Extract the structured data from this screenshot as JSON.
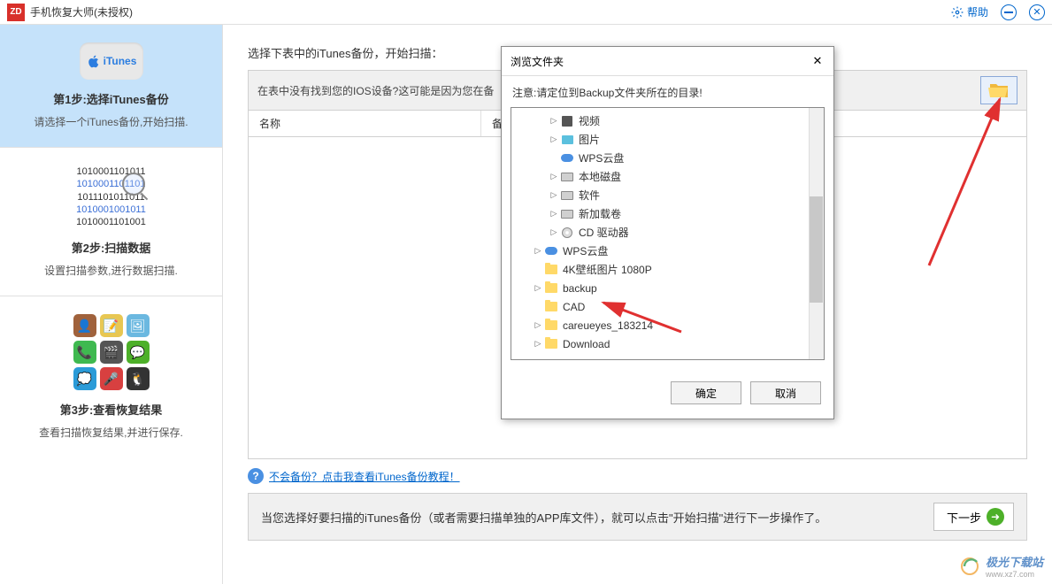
{
  "titlebar": {
    "app_abbr": "ZD",
    "title": "手机恢复大师(未授权)",
    "help": "帮助"
  },
  "sidebar": {
    "step1": {
      "itunes": "iTunes",
      "title": "第1步:选择iTunes备份",
      "desc": "请选择一个iTunes备份,开始扫描."
    },
    "step2": {
      "binary": [
        "1010001101011",
        "1010001101101",
        "1011101011011",
        "1010001001011",
        "1010001101001"
      ],
      "title": "第2步:扫描数据",
      "desc": "设置扫描参数,进行数据扫描."
    },
    "step3": {
      "title": "第3步:查看恢复结果",
      "desc": "查看扫描恢复结果,并进行保存."
    }
  },
  "content": {
    "heading": "选择下表中的iTunes备份，开始扫描：",
    "warning": "在表中没有找到您的IOS设备?这可能是因为您在备",
    "columns": {
      "c1": "名称",
      "c2": "备",
      "c3": ""
    },
    "help_link": "不会备份？点击我查看iTunes备份教程！",
    "footer_text": "当您选择好要扫描的iTunes备份（或者需要扫描单独的APP库文件），就可以点击\"开始扫描\"进行下一步操作了。",
    "next": "下一步"
  },
  "dialog": {
    "title": "浏览文件夹",
    "note": "注意:请定位到Backup文件夹所在的目录!",
    "tree": [
      {
        "indent": 2,
        "icon": "film",
        "label": "视频",
        "exp": "▷"
      },
      {
        "indent": 2,
        "icon": "pic",
        "label": "图片",
        "exp": "▷"
      },
      {
        "indent": 2,
        "icon": "cloud",
        "label": "WPS云盘",
        "exp": ""
      },
      {
        "indent": 2,
        "icon": "disk",
        "label": "本地磁盘",
        "exp": "▷"
      },
      {
        "indent": 2,
        "icon": "disk",
        "label": "软件",
        "exp": "▷"
      },
      {
        "indent": 2,
        "icon": "disk",
        "label": "新加载卷",
        "exp": "▷"
      },
      {
        "indent": 2,
        "icon": "cd",
        "label": "CD 驱动器",
        "exp": "▷"
      },
      {
        "indent": 1,
        "icon": "cloud",
        "label": "WPS云盘",
        "exp": "▷"
      },
      {
        "indent": 1,
        "icon": "folder",
        "label": "4K壁纸图片 1080P",
        "exp": ""
      },
      {
        "indent": 1,
        "icon": "folder",
        "label": "backup",
        "exp": "▷"
      },
      {
        "indent": 1,
        "icon": "folder",
        "label": "CAD",
        "exp": ""
      },
      {
        "indent": 1,
        "icon": "folder",
        "label": "careueyes_183214",
        "exp": "▷"
      },
      {
        "indent": 1,
        "icon": "folder",
        "label": "Download",
        "exp": "▷"
      }
    ],
    "ok": "确定",
    "cancel": "取消"
  },
  "watermark": {
    "text": "极光下载站",
    "sub": "www.xz7.com"
  }
}
